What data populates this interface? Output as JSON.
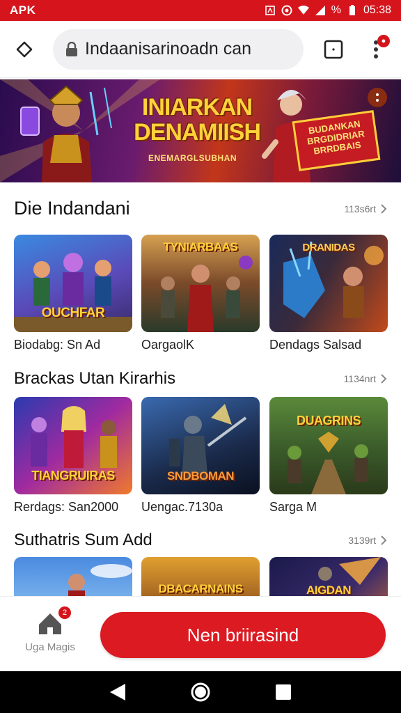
{
  "status_bar": {
    "left_label": "APK",
    "percent_label": "%",
    "time": "05:38"
  },
  "browser": {
    "url": "Indaanisarinoadn can",
    "tab_icon": "square-tab-icon",
    "menu_icon": "kebab-menu-icon",
    "home_icon": "diamond-home-icon",
    "lock_icon": "lock-icon"
  },
  "banner": {
    "title_line1": "INIARKAN",
    "title_line2": "DENAMIISH",
    "tagline": "ENEMARGLSUBHAN",
    "sign_text": "BUDANKAN BRGDIDRIAR BRRDBAIS"
  },
  "sections": [
    {
      "title": "Die Indandani",
      "count": "113s6rt",
      "cards": [
        {
          "label": "Biodabg: Sn Ad",
          "art_title": "OUCHFAR"
        },
        {
          "label": "OargaolK",
          "art_title": "TYNIARBAAS"
        },
        {
          "label": "Dendags Salsad",
          "art_title": "DRANIDAS"
        }
      ]
    },
    {
      "title": "Brackas Utan Kirarhis",
      "count": "1134nrt",
      "cards": [
        {
          "label": "Rerdags: San2000",
          "art_title": "TIANGRUIRAS"
        },
        {
          "label": "Uengac.7130a",
          "art_title": "SNDBOMAN"
        },
        {
          "label": "Sarga M",
          "art_title": "DUAGRINS"
        }
      ]
    },
    {
      "title": "Suthatris Sum Add",
      "count": "3139rt",
      "cards": [
        {
          "label": "",
          "art_title": ""
        },
        {
          "label": "",
          "art_title": "DBACARNAINS"
        },
        {
          "label": "",
          "art_title": "AIGDAN"
        }
      ]
    }
  ],
  "bottom": {
    "mini_app_label": "Uga Magis",
    "mini_app_badge": "2",
    "primary_button": "Nen briirasind"
  },
  "colors": {
    "accent": "#d6141c",
    "button": "#db1a22"
  }
}
